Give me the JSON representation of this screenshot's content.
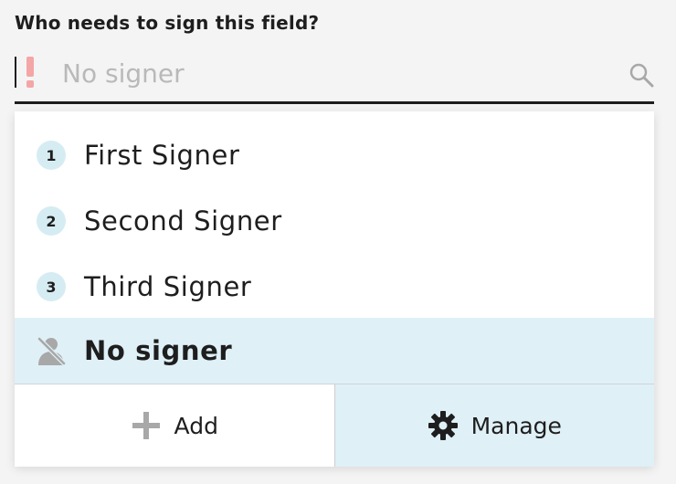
{
  "field_label": "Who needs to sign this field?",
  "search": {
    "placeholder": "No signer",
    "value": ""
  },
  "options": [
    {
      "number": "1",
      "label": "First Signer"
    },
    {
      "number": "2",
      "label": "Second Signer"
    },
    {
      "number": "3",
      "label": "Third Signer"
    }
  ],
  "selected_option": {
    "label": "No signer",
    "icon": "no-signer-icon"
  },
  "footer": {
    "add_label": "Add",
    "manage_label": "Manage"
  },
  "colors": {
    "warning": "#f4a6a6",
    "badge_bg": "#d6ecf3",
    "selected_bg": "#dff0f7",
    "icon_gray": "#a8a8a8",
    "text": "#1e1e1e"
  }
}
